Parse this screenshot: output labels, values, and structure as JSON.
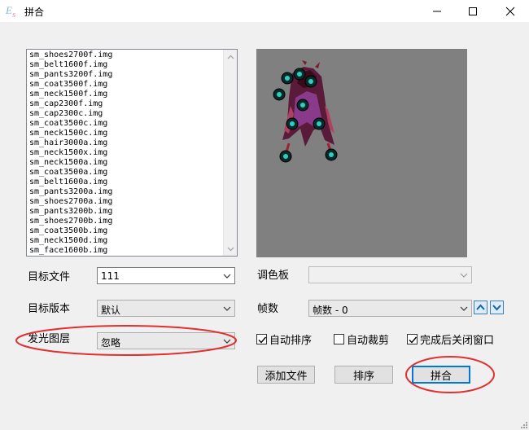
{
  "window": {
    "title": "拼合",
    "logo_text": "Es"
  },
  "file_list": {
    "items": [
      "sm_shoes2700f.img",
      "sm_belt1600f.img",
      "sm_pants3200f.img",
      "sm_coat3500f.img",
      "sm_neck1500f.img",
      "sm_cap2300f.img",
      "sm_cap2300c.img",
      "sm_coat3500c.img",
      "sm_neck1500c.img",
      "sm_hair3000a.img",
      "sm_neck1500x.img",
      "sm_neck1500a.img",
      "sm_coat3500a.img",
      "sm_belt1600a.img",
      "sm_pants3200a.img",
      "sm_shoes2700a.img",
      "sm_pants3200b.img",
      "sm_shoes2700b.img",
      "sm_coat3500b.img",
      "sm_neck1500d.img",
      "sm_face1600b.img"
    ]
  },
  "form": {
    "target_file_label": "目标文件",
    "target_file_value": "111",
    "target_version_label": "目标版本",
    "target_version_value": "默认",
    "glow_layer_label": "发光图层",
    "glow_layer_value": "忽略",
    "palette_label": "调色板",
    "palette_value": "",
    "frames_label": "帧数",
    "frames_value": "帧数 - 0"
  },
  "options": {
    "auto_sort": {
      "label": "自动排序",
      "checked": true
    },
    "auto_crop": {
      "label": "自动裁剪",
      "checked": false
    },
    "close_after": {
      "label": "完成后关闭窗口",
      "checked": true
    }
  },
  "buttons": {
    "add_file": "添加文件",
    "sort": "排序",
    "merge": "拼合"
  },
  "colors": {
    "annotation": "#e03030",
    "preview_bg": "#808080",
    "accent": "#0078d7"
  }
}
